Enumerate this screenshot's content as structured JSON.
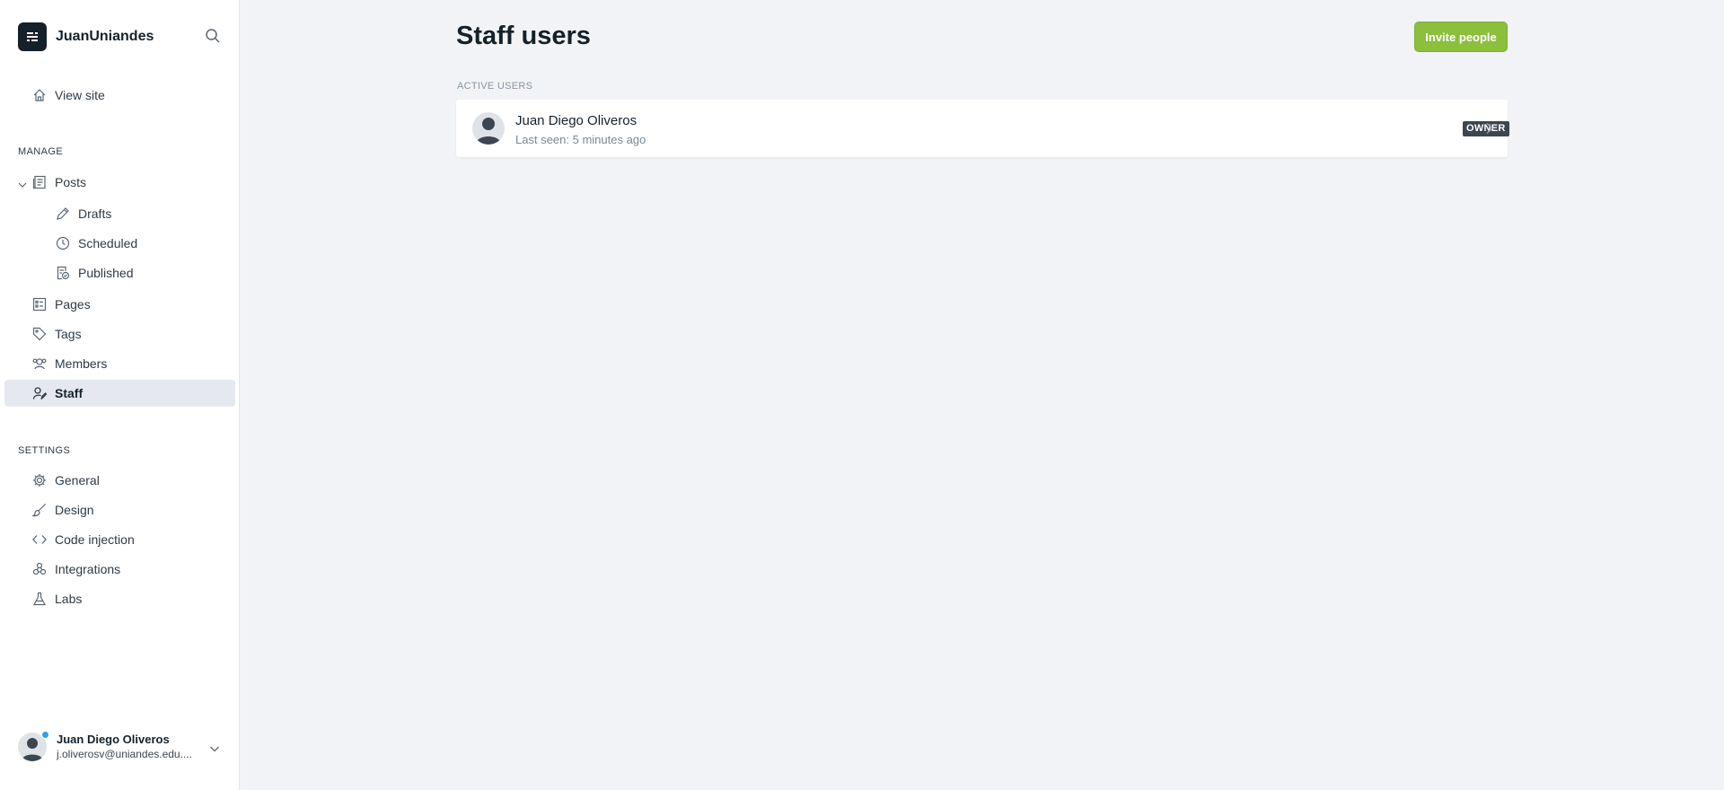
{
  "brand": {
    "name": "JuanUniandes"
  },
  "nav": {
    "view_site": "View site",
    "manage_heading": "MANAGE",
    "posts": "Posts",
    "drafts": "Drafts",
    "scheduled": "Scheduled",
    "published": "Published",
    "pages": "Pages",
    "tags": "Tags",
    "members": "Members",
    "staff": "Staff",
    "settings_heading": "SETTINGS",
    "general": "General",
    "design": "Design",
    "code_injection": "Code injection",
    "integrations": "Integrations",
    "labs": "Labs"
  },
  "current_user": {
    "name": "Juan Diego Oliveros",
    "email": "j.oliverosv@uniandes.edu...."
  },
  "main": {
    "title": "Staff users",
    "invite_label": "Invite people",
    "active_heading": "ACTIVE USERS",
    "users": [
      {
        "name": "Juan Diego Oliveros",
        "last_seen": "Last seen: 5 minutes ago",
        "role": "OWNER"
      }
    ]
  },
  "colors": {
    "accent": "#8bbf3c",
    "active_nav_bg": "#e5e8ee",
    "badge_bg": "#3c4650",
    "notification_dot": "#30a1e9"
  }
}
